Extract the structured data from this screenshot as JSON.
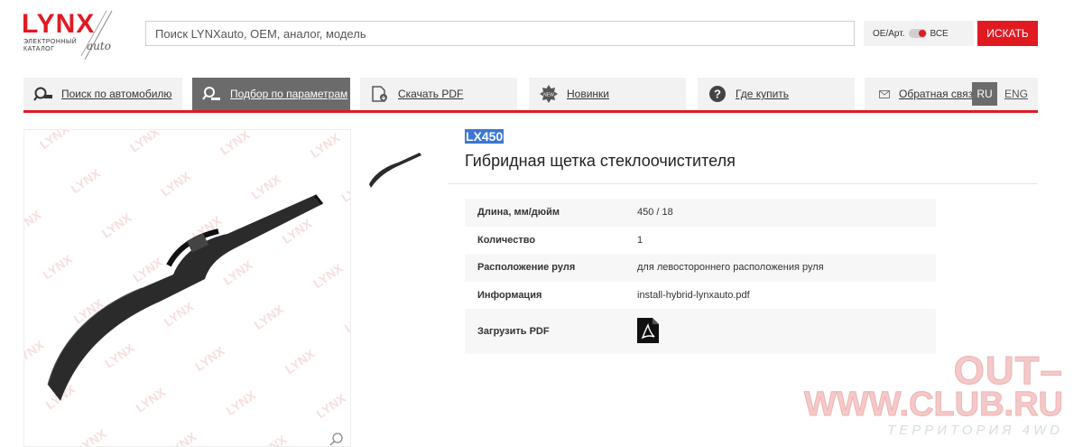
{
  "header": {
    "logo_text": "LYNX",
    "logo_sub_line1": "ЭЛЕКТРОННЫЙ",
    "logo_sub_line2": "КАТАЛОГ",
    "logo_auto": "auto",
    "search_placeholder": "Поиск LYNXauto, OEM, аналог, модель",
    "oe_label": "OE/Арт.",
    "all_label": "ВСЕ",
    "search_button": "ИСКАТЬ"
  },
  "nav": {
    "items": [
      {
        "label": "Поиск по автомобилю",
        "icon": "car-search-icon"
      },
      {
        "label": "Подбор по параметрам",
        "icon": "params-search-icon",
        "active": true
      },
      {
        "label": "Скачать PDF",
        "icon": "pdf-download-icon"
      },
      {
        "label": "Новинки",
        "icon": "new-badge-icon"
      },
      {
        "label": "Где купить",
        "icon": "question-icon"
      },
      {
        "label": "Обратная связь",
        "icon": "mail-icon"
      }
    ],
    "lang_ru": "RU",
    "lang_eng": "ENG"
  },
  "product": {
    "sku": "LX450",
    "title": "Гибридная щетка стеклоочистителя",
    "specs": [
      {
        "key": "Длина, мм/дюйм",
        "value": "450 / 18"
      },
      {
        "key": "Количество",
        "value": "1"
      },
      {
        "key": "Расположение руля",
        "value": "для левостороннего расположения руля"
      },
      {
        "key": "Информация",
        "value": "install-hybrid-lynxauto.pdf"
      }
    ],
    "pdf_label": "Загрузить PDF"
  },
  "watermark": {
    "line1": "OUT–",
    "line2": "WWW.CLUB.RU",
    "line3": "ТЕРРИТОРИЯ 4WD"
  },
  "colors": {
    "brand": "#e11a22",
    "nav_bg": "#f2f2f2",
    "nav_active": "#6b6b6b"
  }
}
